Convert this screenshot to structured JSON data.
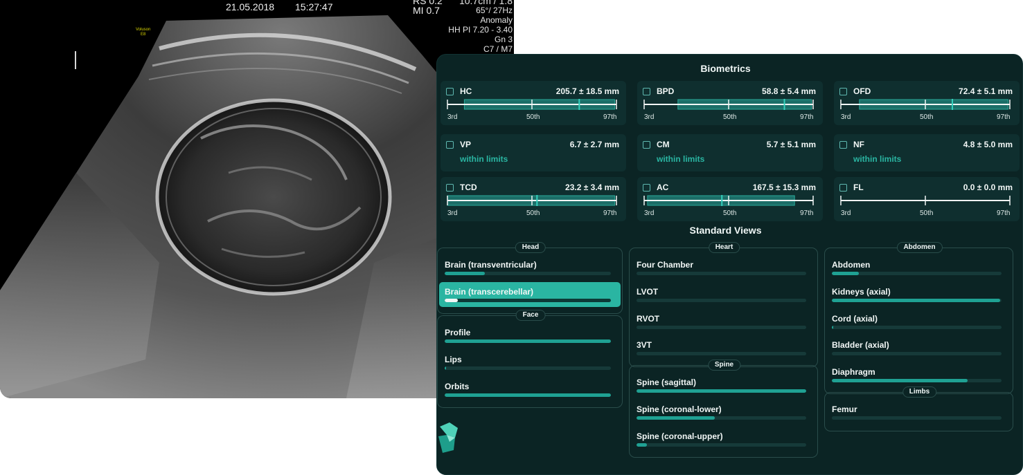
{
  "ultrasound": {
    "date": "21.05.2018",
    "time": "15:27:47",
    "mi_lines": [
      "RS  0.2",
      "MI  0.7"
    ],
    "logo": [
      "Voluson",
      "E8"
    ],
    "params": [
      "10.7cm / 1.8",
      "65°/ 27Hz",
      "Anomaly",
      "HH PI 7.20 - 3.40",
      "Gn   3",
      "C7 / M7"
    ]
  },
  "biometrics": {
    "title": "Biometrics",
    "percentile_ticks": [
      "3rd",
      "50th",
      "97th"
    ],
    "items": [
      {
        "name": "HC",
        "value": "205.7 ± 18.5 mm",
        "kind": "scale",
        "range": [
          0.1,
          0.99
        ],
        "marker": 0.78
      },
      {
        "name": "BPD",
        "value": "58.8 ± 5.4 mm",
        "kind": "scale",
        "range": [
          0.2,
          0.99
        ],
        "marker": 0.83
      },
      {
        "name": "OFD",
        "value": "72.4 ± 5.1 mm",
        "kind": "scale",
        "range": [
          0.11,
          0.99
        ],
        "marker": 0.66
      },
      {
        "name": "VP",
        "value": "6.7 ± 2.7 mm",
        "kind": "status",
        "status": "within limits"
      },
      {
        "name": "CM",
        "value": "5.7 ± 5.1 mm",
        "kind": "status",
        "status": "within limits"
      },
      {
        "name": "NF",
        "value": "4.8 ± 5.0 mm",
        "kind": "status",
        "status": "within limits"
      },
      {
        "name": "TCD",
        "value": "23.2 ± 3.4 mm",
        "kind": "scale",
        "range": [
          0.0,
          0.99
        ],
        "marker": 0.53
      },
      {
        "name": "AC",
        "value": "167.5 ± 15.3 mm",
        "kind": "scale",
        "range": [
          0.02,
          0.89
        ],
        "marker": 0.46
      },
      {
        "name": "FL",
        "value": "0.0 ± 0.0 mm",
        "kind": "scale",
        "range": null,
        "marker": null
      }
    ]
  },
  "standard_views": {
    "title": "Standard Views",
    "groups": [
      {
        "label": "Head",
        "items": [
          {
            "name": "Brain (transventricular)",
            "progress": 0.24,
            "active": false
          },
          {
            "name": "Brain (transcerebellar)",
            "progress": 0.08,
            "active": true
          }
        ]
      },
      {
        "label": "Face",
        "items": [
          {
            "name": "Profile",
            "progress": 1.0,
            "active": false
          },
          {
            "name": "Lips",
            "progress": 0.01,
            "active": false
          },
          {
            "name": "Orbits",
            "progress": 1.0,
            "active": false
          }
        ]
      },
      {
        "label": "Heart",
        "items": [
          {
            "name": "Four Chamber",
            "progress": 0.0,
            "active": false
          },
          {
            "name": "LVOT",
            "progress": 0.0,
            "active": false
          },
          {
            "name": "RVOT",
            "progress": 0.0,
            "active": false
          },
          {
            "name": "3VT",
            "progress": 0.0,
            "active": false
          }
        ]
      },
      {
        "label": "Spine",
        "items": [
          {
            "name": "Spine (sagittal)",
            "progress": 1.0,
            "active": false
          },
          {
            "name": "Spine (coronal-lower)",
            "progress": 0.46,
            "active": false
          },
          {
            "name": "Spine (coronal-upper)",
            "progress": 0.06,
            "active": false
          }
        ]
      },
      {
        "label": "Abdomen",
        "items": [
          {
            "name": "Abdomen",
            "progress": 0.16,
            "active": false
          },
          {
            "name": "Kidneys (axial)",
            "progress": 0.99,
            "active": false
          },
          {
            "name": "Cord (axial)",
            "progress": 0.01,
            "active": false
          },
          {
            "name": "Bladder (axial)",
            "progress": 0.0,
            "active": false
          },
          {
            "name": "Diaphragm",
            "progress": 0.8,
            "active": false
          }
        ]
      },
      {
        "label": "Limbs",
        "items": [
          {
            "name": "Femur",
            "progress": 0.0,
            "active": false
          }
        ]
      }
    ]
  },
  "colors": {
    "accent": "#2ab5a2",
    "panel_bg": "#0b2424",
    "card_bg": "#0f2f2f"
  }
}
